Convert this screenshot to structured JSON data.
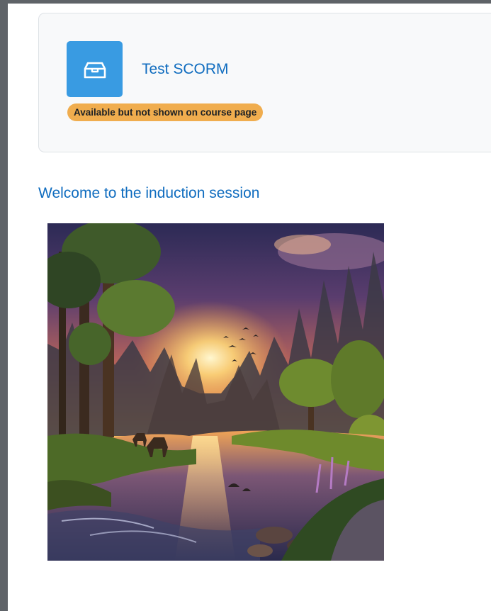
{
  "activity": {
    "icon": "package-box-icon",
    "name": "Test SCORM",
    "availability_badge": "Available but not shown on course page"
  },
  "welcome": {
    "link_text": "Welcome to the induction session"
  },
  "image": {
    "icon": "landscape-image"
  },
  "colors": {
    "link": "#0f6cbf",
    "icon_bg": "#399be2",
    "badge_bg": "#f0ad4e",
    "frame": "#5f6368"
  }
}
